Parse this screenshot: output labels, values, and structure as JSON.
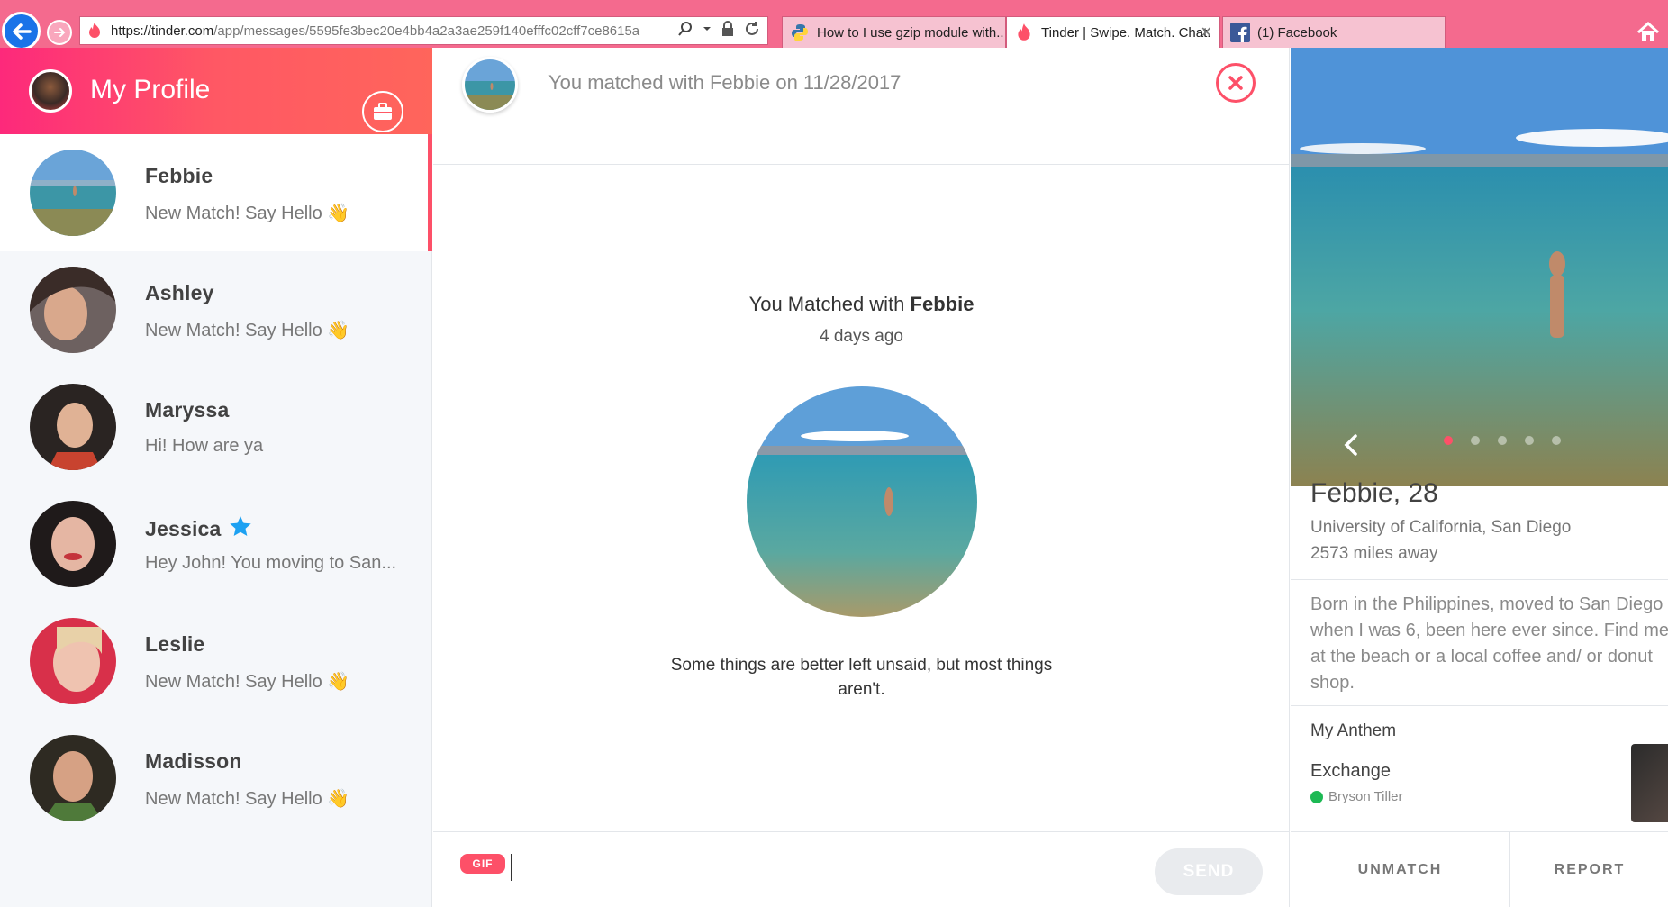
{
  "browser": {
    "url_host": "https://tinder.com",
    "url_path": "/app/messages/5595fe3bec20e4bb4a2a3ae259f140efffc02cff7ce8615a",
    "tabs": [
      {
        "label": "How to I use gzip module with..."
      },
      {
        "label": "Tinder | Swipe. Match. Chat."
      },
      {
        "label": "(1) Facebook"
      }
    ]
  },
  "sidebar": {
    "profile_title": "My Profile",
    "matches": [
      {
        "name": "Febbie",
        "message": "New Match! Say Hello",
        "selected": true
      },
      {
        "name": "Ashley",
        "message": "New Match! Say Hello"
      },
      {
        "name": "Maryssa",
        "message": "Hi! How are ya"
      },
      {
        "name": "Jessica",
        "message": "Hey John! You moving to San...",
        "super_like": true
      },
      {
        "name": "Leslie",
        "message": "New Match! Say Hello"
      },
      {
        "name": "Madisson",
        "message": "New Match! Say Hello"
      }
    ]
  },
  "conversation": {
    "matched_banner": "You matched with Febbie on 11/28/2017",
    "center_title_prefix": "You Matched with ",
    "center_title_name": "Febbie",
    "center_when": "4 days ago",
    "center_bio": "Some things are better left unsaid, but most things aren't.",
    "gif_label": "GIF",
    "input_value": "",
    "send_label": "SEND"
  },
  "profile": {
    "name_age": "Febbie, 28",
    "school": "University of California, San Diego",
    "distance": "2573 miles away",
    "bio": "Born in the Philippines, moved to San Diego\nwhen I was 6, been here ever since. Find me\nat the beach or a local coffee and/ or donut\nshop.",
    "anthem_label": "My Anthem",
    "song": "Exchange",
    "artist": "Bryson Tiller",
    "photo_count": 5,
    "photo_index": 1,
    "unmatch_label": "UNMATCH",
    "report_label": "REPORT"
  },
  "colors": {
    "brand": "#fd5068",
    "chrome": "#f46a8e",
    "super_like": "#1da1f2"
  }
}
